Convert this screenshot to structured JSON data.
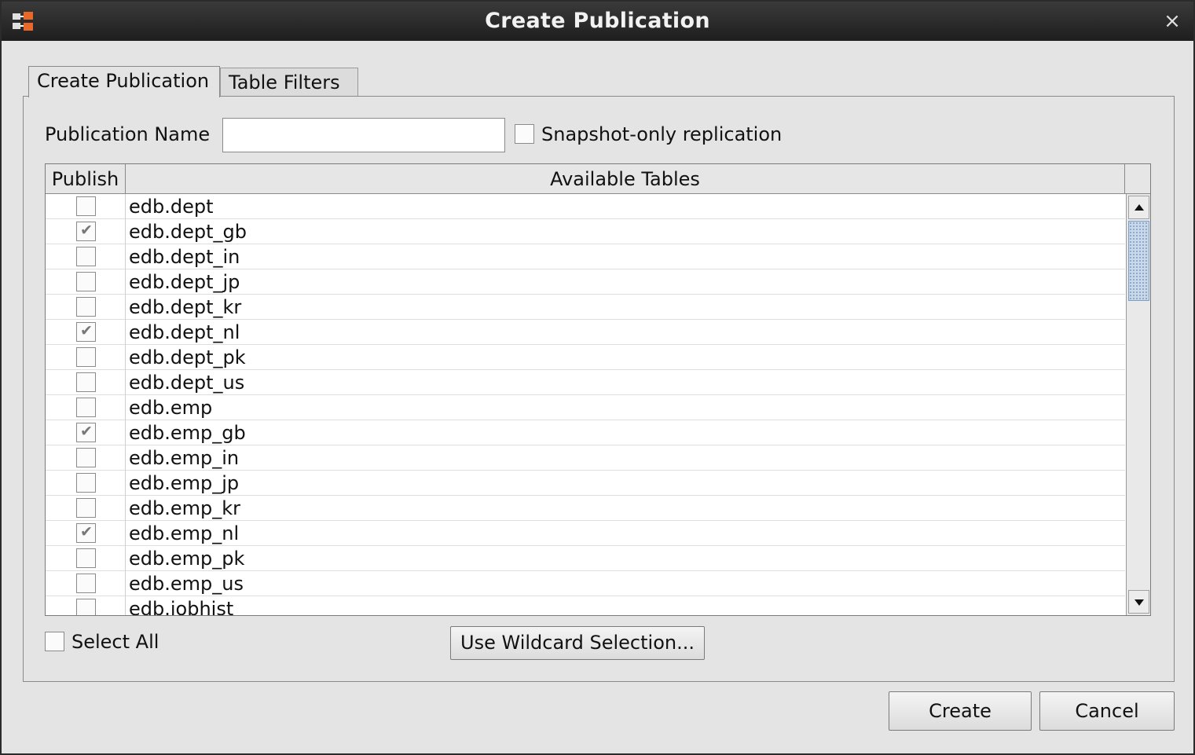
{
  "window": {
    "title": "Create Publication",
    "close_glyph": "×"
  },
  "tabs": [
    {
      "label": "Create Publication",
      "active": true
    },
    {
      "label": "Table Filters",
      "active": false
    }
  ],
  "form": {
    "publication_name_label": "Publication Name",
    "publication_name_value": "",
    "snapshot_label": "Snapshot-only replication",
    "snapshot_checked": false
  },
  "table": {
    "columns": [
      "Publish",
      "Available Tables"
    ],
    "rows": [
      {
        "name": "edb.dept",
        "publish": false
      },
      {
        "name": "edb.dept_gb",
        "publish": true
      },
      {
        "name": "edb.dept_in",
        "publish": false
      },
      {
        "name": "edb.dept_jp",
        "publish": false
      },
      {
        "name": "edb.dept_kr",
        "publish": false
      },
      {
        "name": "edb.dept_nl",
        "publish": true
      },
      {
        "name": "edb.dept_pk",
        "publish": false
      },
      {
        "name": "edb.dept_us",
        "publish": false
      },
      {
        "name": "edb.emp",
        "publish": false
      },
      {
        "name": "edb.emp_gb",
        "publish": true
      },
      {
        "name": "edb.emp_in",
        "publish": false
      },
      {
        "name": "edb.emp_jp",
        "publish": false
      },
      {
        "name": "edb.emp_kr",
        "publish": false
      },
      {
        "name": "edb.emp_nl",
        "publish": true
      },
      {
        "name": "edb.emp_pk",
        "publish": false
      },
      {
        "name": "edb.emp_us",
        "publish": false
      },
      {
        "name": "edb.jobhist",
        "publish": false
      }
    ]
  },
  "footer": {
    "select_all_label": "Select All",
    "select_all_checked": false,
    "wildcard_button": "Use Wildcard Selection...",
    "create_button": "Create",
    "cancel_button": "Cancel"
  },
  "colors": {
    "titlebar": "#1e1e1e",
    "window_bg": "#e4e4e4",
    "scroll_thumb": "#c9d9ea"
  }
}
